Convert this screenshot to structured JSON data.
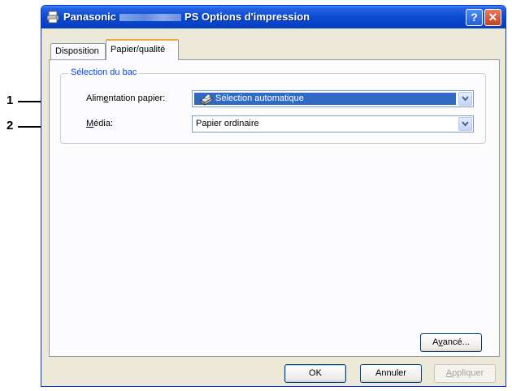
{
  "callouts": [
    "1",
    "2"
  ],
  "window": {
    "title_prefix": "Panasonic",
    "title_suffix": "PS Options d'impression",
    "help_label": "?",
    "close_label": "✕"
  },
  "tabs": [
    {
      "label": "Disposition",
      "selected": false
    },
    {
      "label": "Papier/qualité",
      "selected": true
    }
  ],
  "group": {
    "legend": "Sélection du bac",
    "paper_source": {
      "label_pre": "Alim",
      "label_ul": "e",
      "label_post": "ntation papier:",
      "value": "Sélection automatique",
      "icon": "printer-tray-icon"
    },
    "media": {
      "label_ul": "M",
      "label_post": "édia:",
      "value": "Papier ordinaire"
    }
  },
  "buttons": {
    "advanced": {
      "pre": "A",
      "ul": "v",
      "post": "ancé..."
    },
    "ok": "OK",
    "cancel": "Annuler",
    "apply": {
      "ul": "A",
      "post": "ppliquer"
    }
  },
  "colors": {
    "titlebar": "#0a4bd4",
    "dialog_bg": "#ece9d8",
    "selection": "#316ac5",
    "legend_text": "#0046d5"
  }
}
